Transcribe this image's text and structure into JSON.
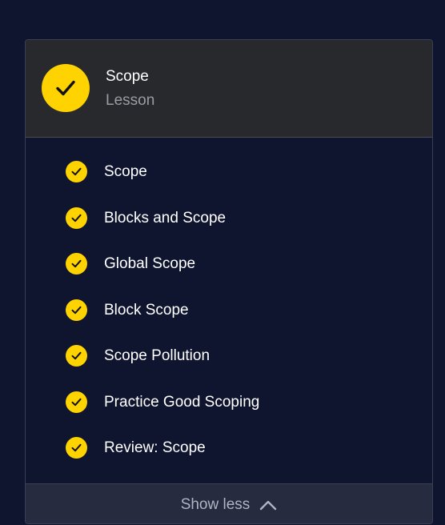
{
  "lesson": {
    "title": "Scope",
    "subtitle": "Lesson",
    "status_icon": "check-circle-icon"
  },
  "items": [
    {
      "label": "Scope",
      "status_icon": "check-circle-icon"
    },
    {
      "label": "Blocks and Scope",
      "status_icon": "check-circle-icon"
    },
    {
      "label": "Global Scope",
      "status_icon": "check-circle-icon"
    },
    {
      "label": "Block Scope",
      "status_icon": "check-circle-icon"
    },
    {
      "label": "Scope Pollution",
      "status_icon": "check-circle-icon"
    },
    {
      "label": "Practice Good Scoping",
      "status_icon": "check-circle-icon"
    },
    {
      "label": "Review: Scope",
      "status_icon": "check-circle-icon"
    }
  ],
  "footer": {
    "toggle_label": "Show less",
    "toggle_icon": "chevron-up-icon"
  },
  "colors": {
    "page_background": "#10152f",
    "header_background": "#28292d",
    "accent_yellow": "#ffd300",
    "footer_background": "#262b40"
  }
}
